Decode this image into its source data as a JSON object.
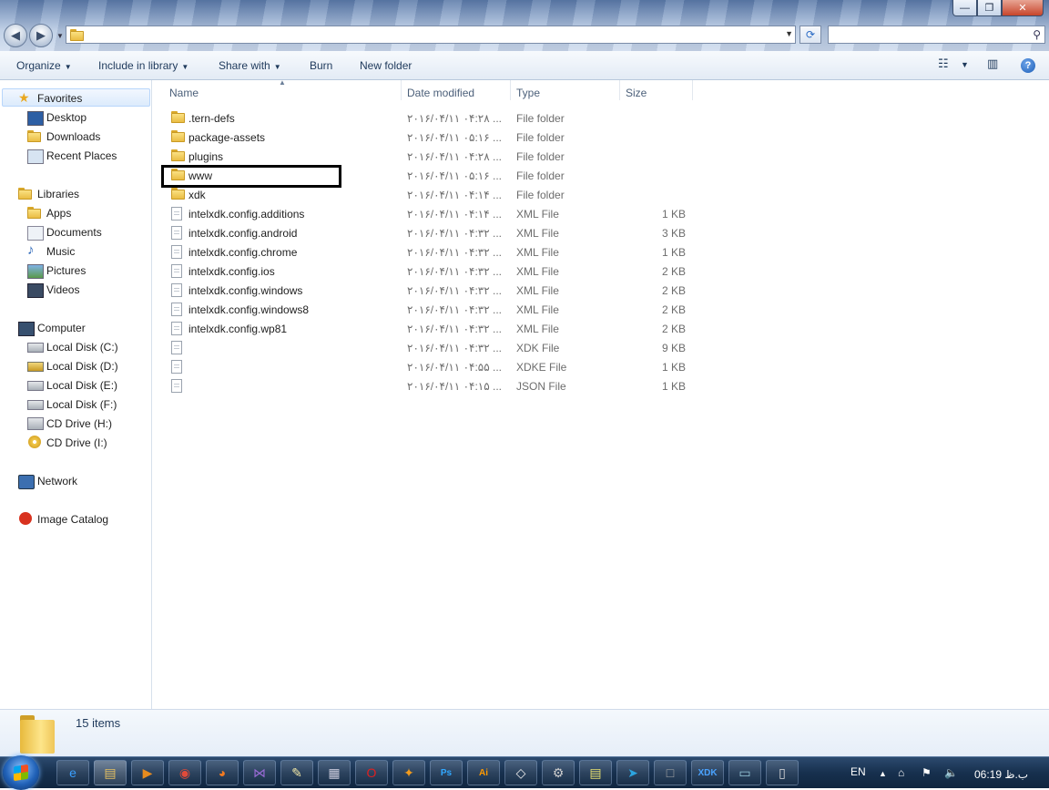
{
  "window": {
    "minimize": "—",
    "maximize": "❐",
    "close": "✕"
  },
  "toolbar": {
    "organize": "Organize",
    "include_in_library": "Include in library",
    "share_with": "Share with",
    "burn": "Burn",
    "new_folder": "New folder"
  },
  "navigation": {
    "favorites": {
      "label": "Favorites",
      "items": [
        "Desktop",
        "Downloads",
        "Recent Places"
      ]
    },
    "libraries": {
      "label": "Libraries",
      "items": [
        "Apps",
        "Documents",
        "Music",
        "Pictures",
        "Videos"
      ]
    },
    "computer": {
      "label": "Computer",
      "items": [
        "Local Disk (C:)",
        "Local Disk (D:)",
        "Local Disk (E:)",
        "Local Disk (F:)",
        "CD Drive (H:)",
        "CD Drive (I:)"
      ]
    },
    "network": "Network",
    "image_catalog": "Image Catalog"
  },
  "columns": {
    "name": "Name",
    "date": "Date modified",
    "type": "Type",
    "size": "Size"
  },
  "files": [
    {
      "name": ".tern-defs",
      "date": "۲۰۱۶/۰۴/۱۱ ۰۴:۲۸ ...",
      "type": "File folder",
      "size": "",
      "kind": "folder"
    },
    {
      "name": "package-assets",
      "date": "۲۰۱۶/۰۴/۱۱ ۰۵:۱۶ ...",
      "type": "File folder",
      "size": "",
      "kind": "folder"
    },
    {
      "name": "plugins",
      "date": "۲۰۱۶/۰۴/۱۱ ۰۴:۲۸ ...",
      "type": "File folder",
      "size": "",
      "kind": "folder"
    },
    {
      "name": "www",
      "date": "۲۰۱۶/۰۴/۱۱ ۰۵:۱۶ ...",
      "type": "File folder",
      "size": "",
      "kind": "folder"
    },
    {
      "name": "xdk",
      "date": "۲۰۱۶/۰۴/۱۱ ۰۴:۱۴ ...",
      "type": "File folder",
      "size": "",
      "kind": "folder"
    },
    {
      "name": "intelxdk.config.additions",
      "date": "۲۰۱۶/۰۴/۱۱ ۰۴:۱۴ ...",
      "type": "XML File",
      "size": "1 KB",
      "kind": "file"
    },
    {
      "name": "intelxdk.config.android",
      "date": "۲۰۱۶/۰۴/۱۱ ۰۴:۳۲ ...",
      "type": "XML File",
      "size": "3 KB",
      "kind": "file"
    },
    {
      "name": "intelxdk.config.chrome",
      "date": "۲۰۱۶/۰۴/۱۱ ۰۴:۳۲ ...",
      "type": "XML File",
      "size": "1 KB",
      "kind": "file"
    },
    {
      "name": "intelxdk.config.ios",
      "date": "۲۰۱۶/۰۴/۱۱ ۰۴:۳۲ ...",
      "type": "XML File",
      "size": "2 KB",
      "kind": "file"
    },
    {
      "name": "intelxdk.config.windows",
      "date": "۲۰۱۶/۰۴/۱۱ ۰۴:۳۲ ...",
      "type": "XML File",
      "size": "2 KB",
      "kind": "file"
    },
    {
      "name": "intelxdk.config.windows8",
      "date": "۲۰۱۶/۰۴/۱۱ ۰۴:۳۲ ...",
      "type": "XML File",
      "size": "2 KB",
      "kind": "file"
    },
    {
      "name": "intelxdk.config.wp81",
      "date": "۲۰۱۶/۰۴/۱۱ ۰۴:۳۲ ...",
      "type": "XML File",
      "size": "2 KB",
      "kind": "file"
    },
    {
      "name": "",
      "date": "۲۰۱۶/۰۴/۱۱ ۰۴:۳۲ ...",
      "type": "XDK File",
      "size": "9 KB",
      "kind": "file"
    },
    {
      "name": "",
      "date": "۲۰۱۶/۰۴/۱۱ ۰۴:۵۵ ...",
      "type": "XDKE File",
      "size": "1 KB",
      "kind": "file"
    },
    {
      "name": "",
      "date": "۲۰۱۶/۰۴/۱۱ ۰۴:۱۵ ...",
      "type": "JSON File",
      "size": "1 KB",
      "kind": "file"
    }
  ],
  "status": {
    "count": "15 items"
  },
  "taskbar": {
    "apps": [
      "ie-icon",
      "explorer-icon",
      "media-player-icon",
      "chrome-icon",
      "firefox-icon",
      "visual-studio-icon",
      "notepad-icon",
      "calculator-icon",
      "opera-icon",
      "app-icon",
      "photoshop-icon",
      "illustrator-icon",
      "unity-icon",
      "settings-icon",
      "notes-icon",
      "telegram-icon",
      "blank-app-icon",
      "intel-xdk-icon",
      "window-icon",
      "notepad2-icon"
    ],
    "lang": "EN",
    "time": "06:19 ب.ظ"
  }
}
